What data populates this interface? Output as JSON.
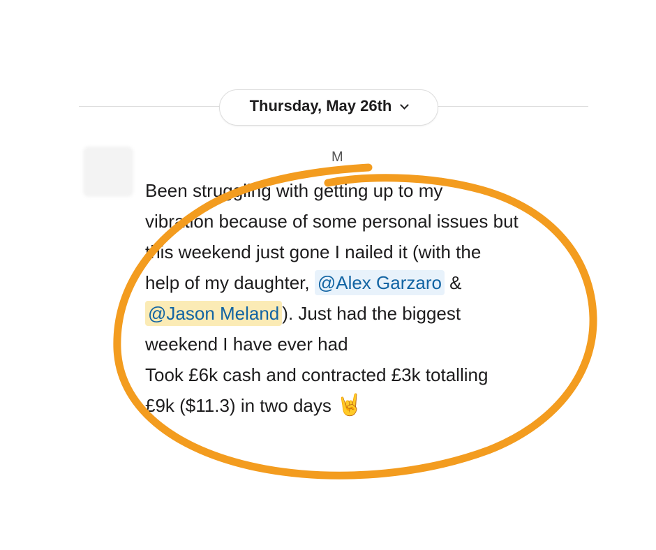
{
  "date_divider": {
    "label": "Thursday, May 26th"
  },
  "message": {
    "author": "M",
    "lines": [
      "Been struggling with getting up to my",
      "vibration because of some personal issues but",
      "this weekend just gone I nailed it (with the"
    ],
    "line4_prefix": "help of my daughter, ",
    "mention_1": "@Alex Garzaro",
    "line4_suffix": " &",
    "mention_2": "@Jason Meland",
    "line5_suffix": "). Just had the biggest",
    "line6": "weekend I have ever had",
    "line7": "Took £6k cash and contracted £3k  totalling",
    "line8": "£9k ($11.3) in two days",
    "emoji": "🤘"
  },
  "colors": {
    "mention_text": "#1264a3",
    "mention_bg": "#e8f2fb",
    "mention_highlight_bg": "#fbebb5",
    "annotation_stroke": "#f39c1f"
  }
}
